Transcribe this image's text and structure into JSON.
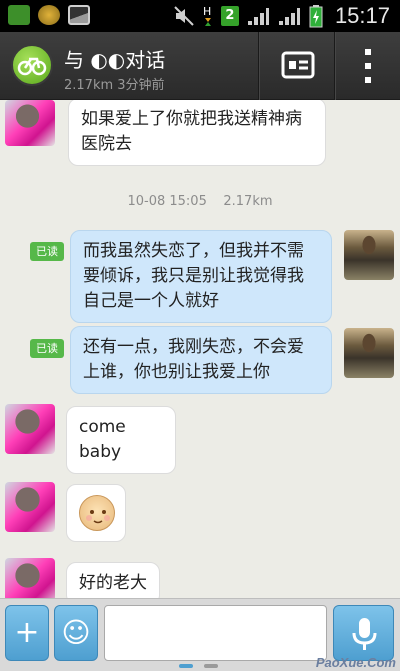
{
  "status_bar": {
    "time": "15:17",
    "badge": "2",
    "left_icons": [
      "sim-icon",
      "sync-icon",
      "image-icon"
    ],
    "right_icons": [
      "mute-icon",
      "data-icon",
      "signal-icon",
      "signal-icon",
      "battery-icon"
    ]
  },
  "header": {
    "title": "与 ◐◐对话",
    "subtitle": "2.17km 3分钟前",
    "card_icon": "profile-card-icon",
    "more_icon": "more-vertical-icon"
  },
  "chat": {
    "timestamp": "10-08 15:05    2.17km",
    "read_label": "已读",
    "messages": [
      {
        "side": "left",
        "text": "如果爱上了你就把我送精神病\n医院去"
      },
      {
        "side": "right",
        "text": "而我虽然失恋了，但我并不需\n要倾诉，我只是别让我觉得我\n自己是一个人就好"
      },
      {
        "side": "right",
        "text": "还有一点，我刚失恋，不会爱\n上谁，你也别让我爱上你"
      },
      {
        "side": "left",
        "text": "come baby"
      },
      {
        "side": "left",
        "text": "emoji"
      },
      {
        "side": "left",
        "text": "好的老大"
      }
    ]
  },
  "input_bar": {
    "plus_label": "+",
    "emoji_label": "☺",
    "placeholder": "",
    "mic_icon": "microphone-icon"
  },
  "watermark": "PaoXue.Com",
  "colors": {
    "header_bg": "#2f2f2f",
    "sent_bubble": "#cfe7fb",
    "received_bubble": "#ffffff",
    "read_badge": "#56b849",
    "button_blue": "#5aa9d8"
  }
}
